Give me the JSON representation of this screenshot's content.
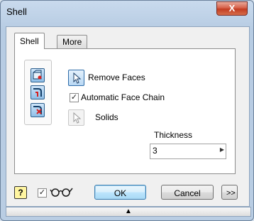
{
  "window": {
    "title": "Shell",
    "close_glyph": "X"
  },
  "tabs": [
    {
      "label": "Shell"
    },
    {
      "label": "More"
    }
  ],
  "selection_icons": [
    "shell-face-icon",
    "shell-edge-icon",
    "shell-body-icon"
  ],
  "remove_faces": {
    "label": "Remove Faces",
    "icon": "cursor-arrow-icon"
  },
  "automatic_face_chain": {
    "label": "Automatic Face Chain",
    "checked": true
  },
  "solids": {
    "label": "Solids",
    "icon": "cursor-arrow-icon"
  },
  "thickness": {
    "label": "Thickness",
    "value": "3",
    "spin_glyph": "▶"
  },
  "bottom": {
    "help_label": "?",
    "preview_checked": true,
    "preview_icon": "glasses-icon",
    "ok_label": "OK",
    "cancel_label": "Cancel",
    "more_label": ">>",
    "expander_glyph": "▲"
  },
  "colors": {
    "accent": "#3c7fb1",
    "close": "#c23c22"
  }
}
